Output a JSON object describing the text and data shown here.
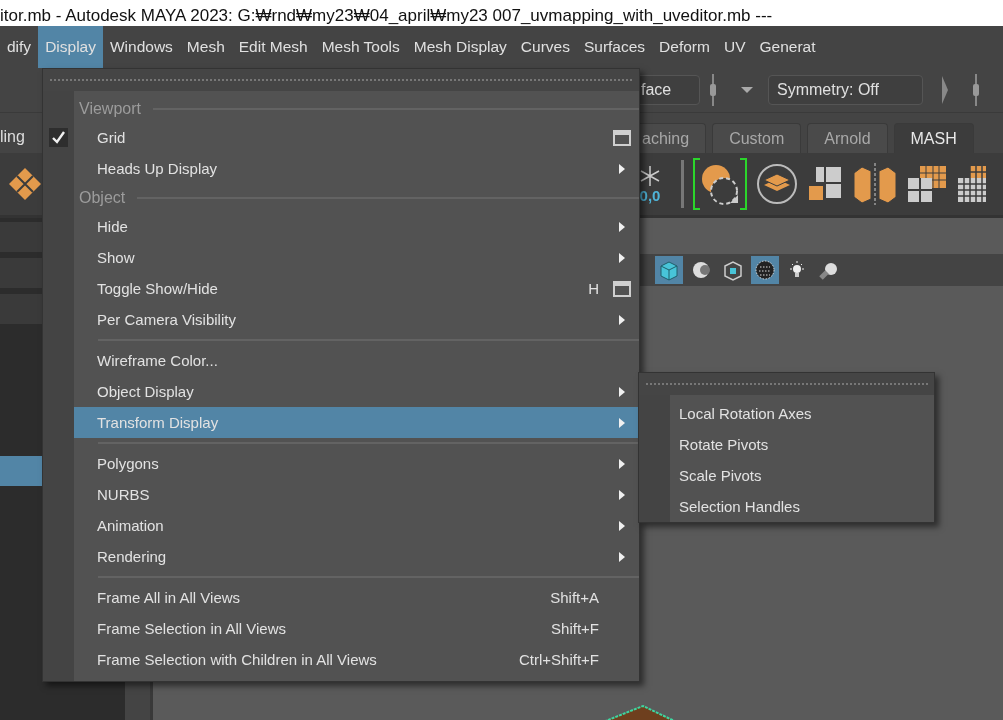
{
  "title_bar": {
    "title": "itor.mb  -  Autodesk MAYA 2023: G:₩rnd₩my23₩04_april₩my23 007_uvmapping_with_uveditor.mb   ---"
  },
  "menu_bar": {
    "items": [
      {
        "label": "dify",
        "selected": false
      },
      {
        "label": "Display",
        "selected": true
      },
      {
        "label": "Windows",
        "selected": false
      },
      {
        "label": "Mesh",
        "selected": false
      },
      {
        "label": "Edit Mesh",
        "selected": false
      },
      {
        "label": "Mesh Tools",
        "selected": false
      },
      {
        "label": "Mesh Display",
        "selected": false
      },
      {
        "label": "Curves",
        "selected": false
      },
      {
        "label": "Surfaces",
        "selected": false
      },
      {
        "label": "Deform",
        "selected": false
      },
      {
        "label": "UV",
        "selected": false
      },
      {
        "label": "Generat",
        "selected": false
      }
    ]
  },
  "status_line": {
    "selection_field": "face",
    "symmetry_field": "Symmetry: Off"
  },
  "left_panel": {
    "tab": "ling",
    "rows": [
      {
        "selected": false
      },
      {
        "selected": false
      },
      {
        "selected": false
      },
      {
        "selected": true
      }
    ]
  },
  "shelf": {
    "tabs": [
      {
        "label": "aching",
        "selected": false
      },
      {
        "label": "Custom",
        "selected": false
      },
      {
        "label": "Arnold",
        "selected": false
      },
      {
        "label": "MASH",
        "selected": true
      }
    ],
    "snap_value": "0,0"
  },
  "viewport_toolbar": {
    "buttons": [
      {
        "kind": "cube",
        "on": true
      },
      {
        "kind": "sphere",
        "on": false
      },
      {
        "kind": "wire",
        "on": false
      },
      {
        "kind": "checker",
        "on": true
      },
      {
        "kind": "light",
        "on": false
      },
      {
        "kind": "ball",
        "on": false
      }
    ]
  },
  "display_menu": {
    "entries": [
      {
        "kind": "header",
        "label": "Viewport"
      },
      {
        "kind": "item",
        "label": "Grid",
        "checked": true,
        "selected": false,
        "option_box": true
      },
      {
        "kind": "item",
        "label": "Heads Up Display",
        "checked": false,
        "selected": false,
        "submenu": true
      },
      {
        "kind": "header",
        "label": "Object"
      },
      {
        "kind": "item",
        "label": "Hide",
        "checked": false,
        "selected": false,
        "submenu": true
      },
      {
        "kind": "item",
        "label": "Show",
        "checked": false,
        "selected": false,
        "submenu": true
      },
      {
        "kind": "item",
        "label": "Toggle Show/Hide",
        "checked": false,
        "selected": false,
        "shortcut": "H",
        "option_box": true
      },
      {
        "kind": "item",
        "label": "Per Camera Visibility",
        "checked": false,
        "selected": false,
        "submenu": true
      },
      {
        "kind": "separator"
      },
      {
        "kind": "item",
        "label": "Wireframe Color...",
        "checked": false,
        "selected": false
      },
      {
        "kind": "item",
        "label": "Object Display",
        "checked": false,
        "selected": false,
        "submenu": true
      },
      {
        "kind": "item",
        "label": "Transform Display",
        "checked": false,
        "selected": true,
        "submenu": true
      },
      {
        "kind": "separator"
      },
      {
        "kind": "item",
        "label": "Polygons",
        "checked": false,
        "selected": false,
        "submenu": true
      },
      {
        "kind": "item",
        "label": "NURBS",
        "checked": false,
        "selected": false,
        "submenu": true
      },
      {
        "kind": "item",
        "label": "Animation",
        "checked": false,
        "selected": false,
        "submenu": true
      },
      {
        "kind": "item",
        "label": "Rendering",
        "checked": false,
        "selected": false,
        "submenu": true
      },
      {
        "kind": "separator"
      },
      {
        "kind": "item",
        "label": "Frame All in All Views",
        "checked": false,
        "selected": false,
        "shortcut": "Shift+A"
      },
      {
        "kind": "item",
        "label": "Frame Selection in All Views",
        "checked": false,
        "selected": false,
        "shortcut": "Shift+F"
      },
      {
        "kind": "item",
        "label": "Frame Selection with Children in All Views",
        "checked": false,
        "selected": false,
        "shortcut": "Ctrl+Shift+F"
      }
    ]
  },
  "transform_submenu": {
    "items": [
      {
        "label": "Local Rotation Axes",
        "selected": false
      },
      {
        "label": "Rotate Pivots",
        "selected": false
      },
      {
        "label": "Scale Pivots",
        "selected": false
      },
      {
        "label": "Selection Handles",
        "selected": false
      }
    ]
  }
}
